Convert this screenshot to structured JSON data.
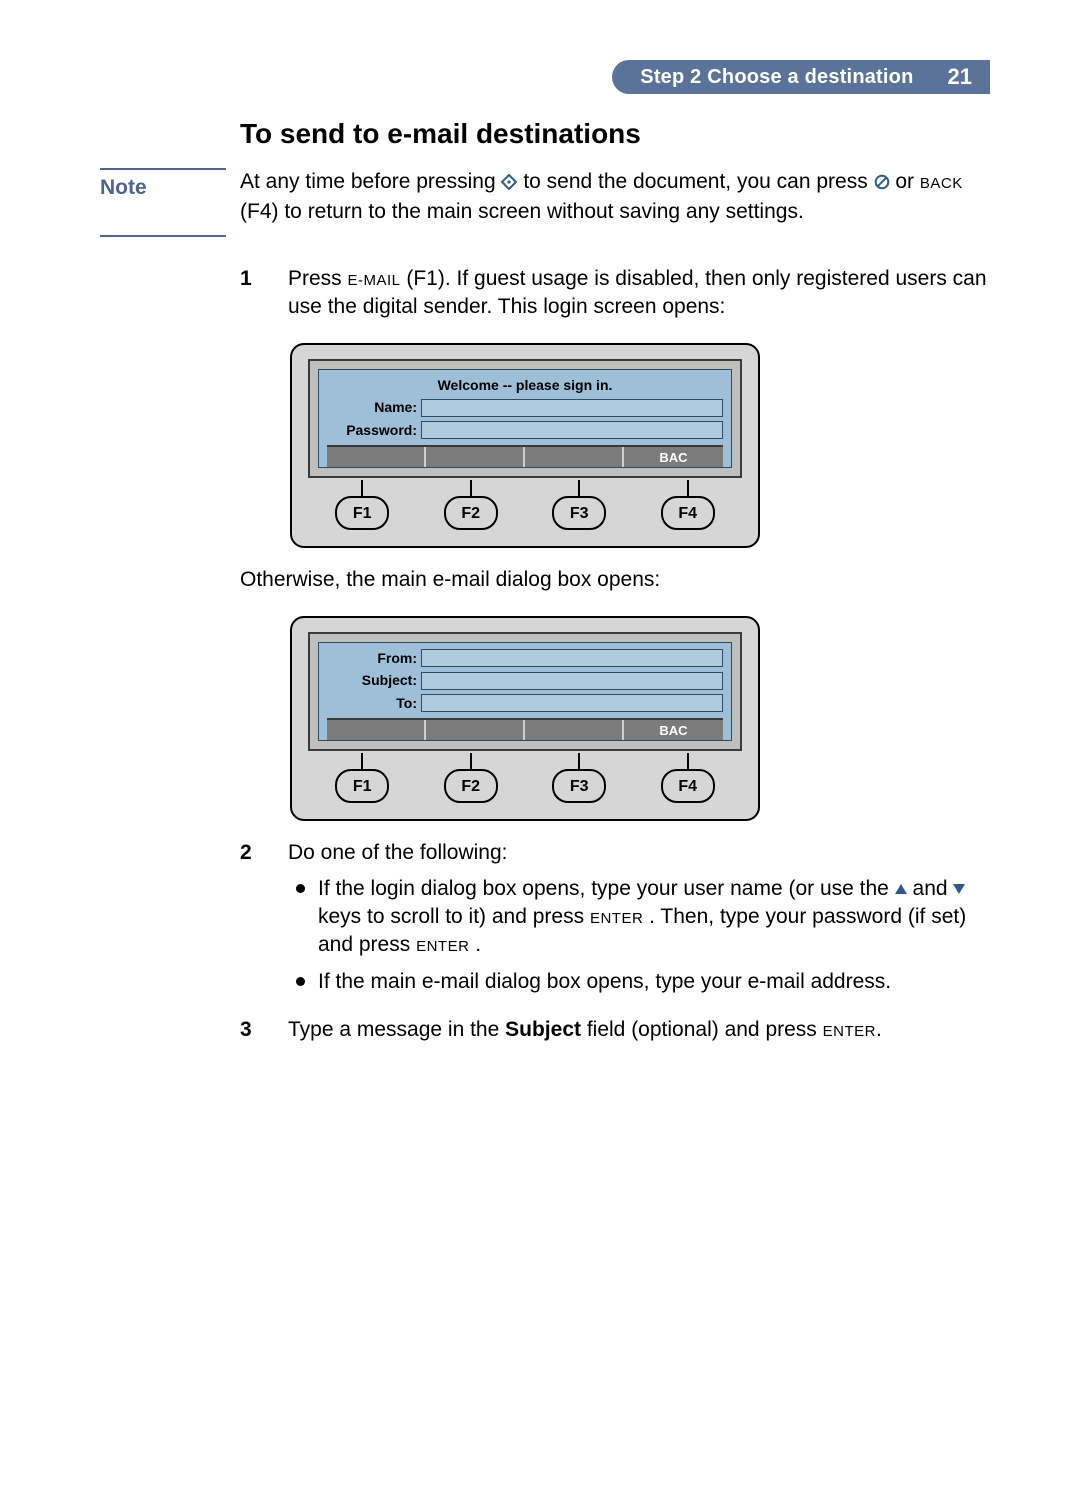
{
  "header": {
    "step_label": "Step 2 Choose a destination",
    "page_number": "21"
  },
  "title": "To send to e-mail destinations",
  "colors": {
    "accent": "#5b7398",
    "note": "#4f658c",
    "screen_bg": "#9fbfd9"
  },
  "note": {
    "label": "Note",
    "p1a": "At any time before pressing ",
    "p1b": " to send the document, you can press ",
    "p1c": " or ",
    "back_sc": "Back",
    "f4": " (F4)",
    "p1d": " to return to the main screen without saving any settings."
  },
  "steps": {
    "s1": {
      "num": "1",
      "t1": "Press ",
      "email_sc": "E-Mail",
      "f1": " (F1)",
      "t2": ". If guest usage is disabled, then only registered users can use the digital sender. This login screen opens:"
    },
    "after_login": "Otherwise, the main e-mail dialog box opens:",
    "s2": {
      "num": "2",
      "t": "Do one of the following:",
      "b1a": "If the login dialog box opens, type your user name (or use the ",
      "b1b": " and ",
      "b1c": " keys to scroll to it) and press ",
      "enter_sc": "Enter",
      "b1d": ". Then, type your password (if set) and press ",
      "b1e": ".",
      "b2": "If the main e-mail dialog box opens, type your e-mail address."
    },
    "s3": {
      "num": "3",
      "t1": "Type a message in the ",
      "subject_bold": "Subject",
      "t2": " field (optional) and press ",
      "enter_sc": "Enter",
      "t3": "."
    }
  },
  "device1": {
    "welcome": "Welcome -- please sign in.",
    "name_label": "Name:",
    "password_label": "Password:",
    "bac": "BAC",
    "fkeys": [
      "F1",
      "F2",
      "F3",
      "F4"
    ]
  },
  "device2": {
    "from_label": "From:",
    "subject_label": "Subject:",
    "to_label": "To:",
    "bac": "BAC",
    "fkeys": [
      "F1",
      "F2",
      "F3",
      "F4"
    ]
  }
}
